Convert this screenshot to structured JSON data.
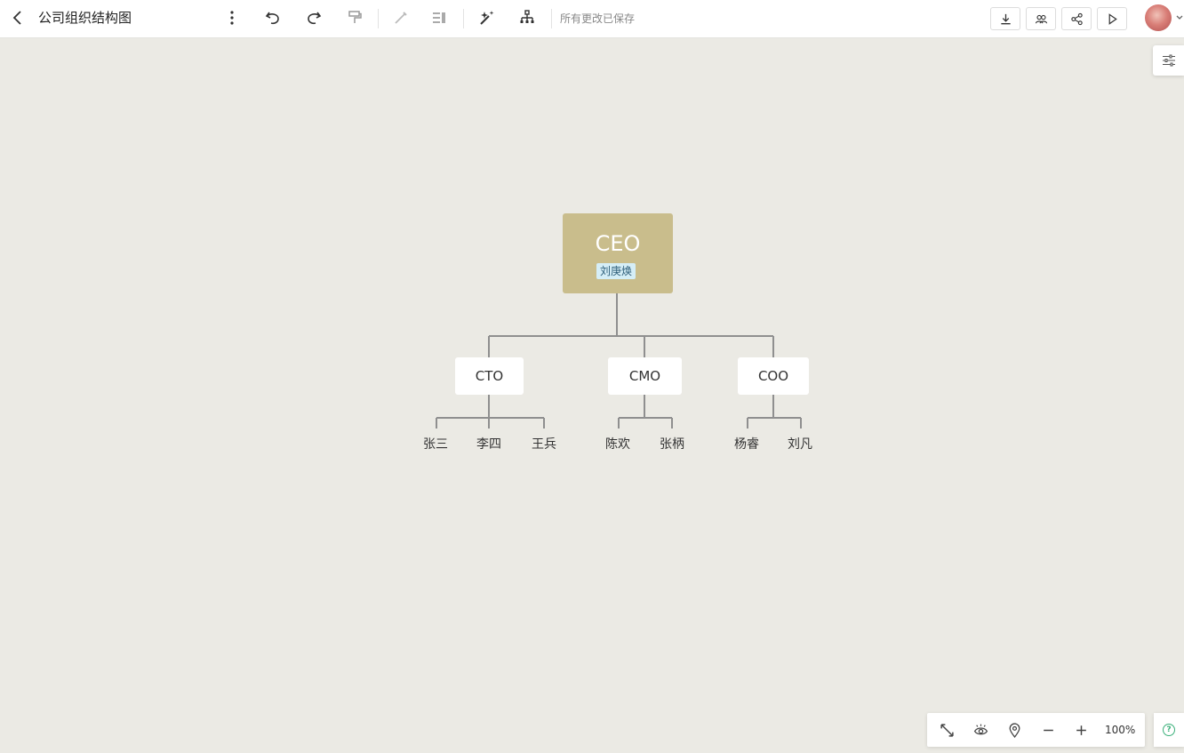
{
  "header": {
    "title": "公司组织结构图",
    "save_status": "所有更改已保存"
  },
  "org_chart": {
    "root": {
      "title": "CEO",
      "tag": "刘庚焕",
      "fill_color": "#c9bd8c",
      "tag_color": "#d5eef7"
    },
    "managers": [
      {
        "title": "CTO",
        "members": [
          "张三",
          "李四",
          "王兵"
        ]
      },
      {
        "title": "CMO",
        "members": [
          "陈欢",
          "张柄"
        ]
      },
      {
        "title": "COO",
        "members": [
          "杨睿",
          "刘凡"
        ]
      }
    ]
  },
  "zoom": {
    "level": "100%"
  },
  "icons": {
    "toolbar": [
      "back-icon",
      "more-icon",
      "undo-icon",
      "redo-icon",
      "format-painter-icon",
      "style-brush-icon",
      "layout-icon",
      "magic-icon",
      "structure-icon"
    ],
    "actions": [
      "download-icon",
      "collaborate-icon",
      "share-icon",
      "present-icon"
    ],
    "bottom": [
      "fit-screen-icon",
      "eye-icon",
      "location-icon",
      "zoom-out-icon",
      "zoom-in-icon"
    ],
    "help": "help-icon"
  },
  "colors": {
    "canvas": "#ebeae4",
    "accent_help": "#3bb07a"
  }
}
